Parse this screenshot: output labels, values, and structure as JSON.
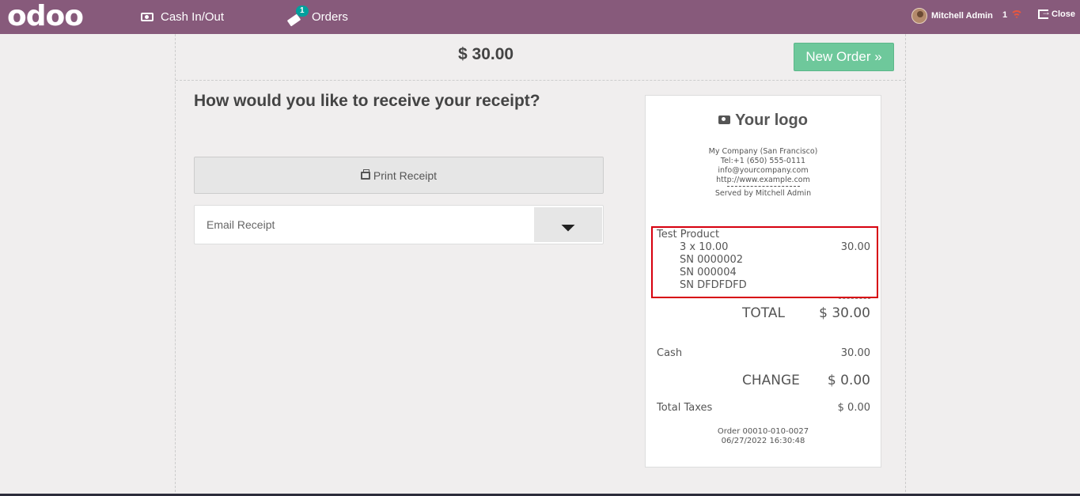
{
  "header": {
    "logo_text": "odoo",
    "cash_label": "Cash In/Out",
    "orders_label": "Orders",
    "orders_badge": "1",
    "user_name": "Mitchell Admin",
    "network_count": "1",
    "close_label": "Close"
  },
  "top_row": {
    "amount": "$ 30.00",
    "new_order_label": "New Order »"
  },
  "receipt_options": {
    "question": "How would you like to receive your receipt?",
    "print_label": "Print Receipt",
    "email_placeholder": "Email Receipt"
  },
  "receipt": {
    "logo_text": "Your logo",
    "company_name": "My Company (San Francisco)",
    "phone": "Tel:+1 (650) 555-0111",
    "email": "info@yourcompany.com",
    "website": "http://www.example.com",
    "served_by": "Served by Mitchell Admin",
    "product_name": "Test Product",
    "qty_price": "3 x 10.00",
    "line_total": "30.00",
    "serials": [
      "SN 0000002",
      "SN 000004",
      "SN DFDFDFD"
    ],
    "total_label": "TOTAL",
    "total_value": "$ 30.00",
    "payment_label": "Cash",
    "payment_value": "30.00",
    "change_label": "CHANGE",
    "change_value": "$ 0.00",
    "taxes_label": "Total Taxes",
    "taxes_value": "$ 0.00",
    "order_ref": "Order 00010-010-0027",
    "order_date": "06/27/2022 16:30:48"
  },
  "colors": {
    "brand": "#875a7b",
    "new_order": "#6ec89b",
    "highlight": "#d7000e",
    "badge": "#00a09d"
  },
  "icons": [
    "cash-icon",
    "ticket-icon",
    "wifi-icon",
    "exit-icon",
    "printer-icon",
    "send-icon",
    "camera-icon"
  ]
}
